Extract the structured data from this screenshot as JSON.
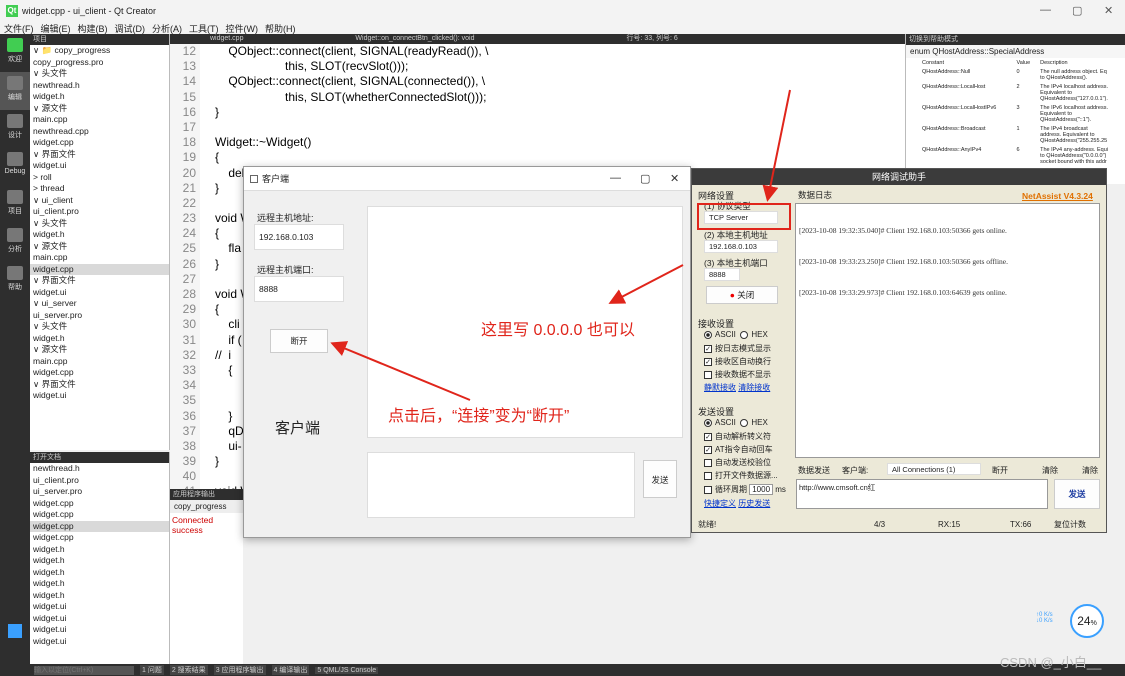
{
  "window": {
    "title": "widget.cpp - ui_client - Qt Creator",
    "min": "—",
    "max": "▢",
    "close": "✕"
  },
  "menu": [
    "文件(F)",
    "编辑(E)",
    "构建(B)",
    "调试(D)",
    "分析(A)",
    "工具(T)",
    "控件(W)",
    "帮助(H)"
  ],
  "modes": [
    {
      "label": "欢迎",
      "icon": "qt-logo-icon"
    },
    {
      "label": "编辑",
      "icon": "edit-icon"
    },
    {
      "label": "设计",
      "icon": "design-icon"
    },
    {
      "label": "Debug",
      "icon": "debug-icon"
    },
    {
      "label": "项目",
      "icon": "project-icon"
    },
    {
      "label": "分析",
      "icon": "analyze-icon"
    },
    {
      "label": "帮助",
      "icon": "help-icon"
    }
  ],
  "project": {
    "header": "项目",
    "items": [
      "∨ 📁 copy_progress",
      "   copy_progress.pro",
      "  ∨ 头文件",
      "     newthread.h",
      "     widget.h",
      "  ∨ 源文件",
      "     main.cpp",
      "     newthread.cpp",
      "     widget.cpp",
      "  ∨ 界面文件",
      "     widget.ui",
      "> roll",
      "> thread",
      "∨ ui_client",
      "   ui_client.pro",
      "  ∨ 头文件",
      "     widget.h",
      "  ∨ 源文件",
      "     main.cpp",
      "     widget.cpp",
      "  ∨ 界面文件",
      "     widget.ui",
      "∨ ui_server",
      "   ui_server.pro",
      "  ∨ 头文件",
      "     widget.h",
      "  ∨ 源文件",
      "     main.cpp",
      "     widget.cpp",
      "  ∨ 界面文件",
      "     widget.ui"
    ],
    "selected": 19
  },
  "open_docs": {
    "header": "打开文档",
    "items": [
      "newthread.h",
      "ui_client.pro",
      "ui_server.pro",
      "widget.cpp",
      "widget.cpp",
      "widget.cpp",
      "widget.cpp",
      "widget.h",
      "widget.h",
      "widget.h",
      "widget.h",
      "widget.h",
      "widget.ui",
      "widget.ui",
      "widget.ui",
      "widget.ui"
    ],
    "selected": 5
  },
  "editor": {
    "tab": "widget.cpp",
    "func": "Widget::on_connectBtn_clicked(): void",
    "pos": "行号: 33, 列号: 6",
    "lines": [
      "12",
      "13",
      "14",
      "15",
      "16",
      "17",
      "18",
      "19",
      "20",
      "21",
      "22",
      "23",
      "24",
      "25",
      "26",
      "27",
      "28",
      "29",
      "30",
      "31",
      "32",
      "33",
      "34",
      "35",
      "36",
      "37",
      "38",
      "39",
      "40",
      "41"
    ],
    "code": [
      "    QObject::connect(client, SIGNAL(readyRead()), \\",
      "                     this, SLOT(recvSlot()));",
      "    QObject::connect(client, SIGNAL(connected()), \\",
      "                     this, SLOT(whetherConnectedSlot()));",
      "}",
      "",
      "Widget::~Widget()",
      "{",
      "    delete ui;",
      "}",
      "",
      "void W",
      "{",
      "    fla",
      "}",
      "",
      "void W",
      "{",
      "    cli",
      "    if (",
      "//  i",
      "    {",
      "",
      "",
      "    }",
      "    qD",
      "    ui-",
      "}",
      "",
      "void W"
    ]
  },
  "help": {
    "header": "切换到帮助模式",
    "title": "enum QHostAddress::SpecialAddress",
    "cols": [
      "Constant",
      "Value",
      "Description"
    ],
    "rows": [
      [
        "QHostAddress::Null",
        "0",
        "The null address object. Eq to QHostAddress()."
      ],
      [
        "QHostAddress::LocalHost",
        "2",
        "The IPv4 localhost address. Equivalent to QHostAddress(\"127.0.0.1\")."
      ],
      [
        "QHostAddress::LocalHostIPv6",
        "3",
        "The IPv6 localhost address. Equivalent to QHostAddress(\"::1\")."
      ],
      [
        "QHostAddress::Broadcast",
        "1",
        "The IPv4 broadcast address. Equivalent to QHostAddress(\"255.255.25"
      ],
      [
        "QHostAddress::AnyIPv4",
        "6",
        "The IPv4 any-address. Equi to QHostAddress(\"0.0.0.0\") socket bound with this addr listen only on IPv4 interfaces"
      ]
    ]
  },
  "output": {
    "header": "应用程序输出",
    "tab": "copy_progress",
    "text": "Connected success"
  },
  "client": {
    "title": "客户端",
    "host_label": "远程主机地址:",
    "host_value": "192.168.0.103",
    "port_label": "远程主机端口:",
    "port_value": "8888",
    "disconnect": "断开",
    "big_label": "客户端",
    "send": "发送"
  },
  "netassist": {
    "title": "网络调试助手",
    "brand": "NetAssist V4.3.24",
    "group_net": "网络设置",
    "proto_label": "(1) 协议类型",
    "proto_value": "TCP Server",
    "host_label": "(2) 本地主机地址",
    "host_value": "192.168.0.103",
    "port_label": "(3) 本地主机端口",
    "port_value": "8888",
    "close_btn": "关闭",
    "log_tab": "数据日志",
    "logs": [
      "[2023-10-08 19:32:35.040]# Client 192.168.0.103:50366 gets online.",
      "[2023-10-08 19:33:23.250]# Client 192.168.0.103:50366 gets offline.",
      "[2023-10-08 19:33:29.973]# Client 192.168.0.103:64639 gets online."
    ],
    "recv_group": "接收设置",
    "recv_ascii": "ASCII",
    "recv_hex": "HEX",
    "recv_opts": [
      "按日志模式显示",
      "接收区自动换行",
      "接收数据不显示"
    ],
    "recv_links": [
      "静默接收",
      "清除接收"
    ],
    "send_group": "发送设置",
    "send_ascii": "ASCII",
    "send_hex": "HEX",
    "send_opts": [
      "自动解析转义符",
      "AT指令自动回车",
      "自动发送校验位",
      "打开文件数据源...",
      "循环周期"
    ],
    "period": "1000",
    "ms": "ms",
    "send_links": [
      "快捷定义",
      "历史发送"
    ],
    "send_tab": "数据发送",
    "client_label": "客户端:",
    "client_select": "All Connections (1)",
    "disc": "断开",
    "clear1": "清除",
    "clear2": "清除",
    "send_text": "http://www.cmsoft.cn红",
    "send_btn": "发送",
    "status": "就绪!",
    "count": "4/3",
    "rx": "RX:15",
    "tx": "TX:66",
    "reset": "复位计数"
  },
  "annotations": [
    "这里写 0.0.0.0 也可以",
    "点击后，“连接”变为“断开”"
  ],
  "status": {
    "search": "输入以定位(Ctrl+K)",
    "tabs": [
      "1 问题",
      "2 搜索结果",
      "3 应用程序输出",
      "4 编译输出",
      "5 QML/JS Console"
    ]
  },
  "meter": {
    "value": "24",
    "unit": "%",
    "up": "↑0 K/s",
    "down": "↓0 K/s"
  },
  "watermark": "CSDN @_小白__"
}
